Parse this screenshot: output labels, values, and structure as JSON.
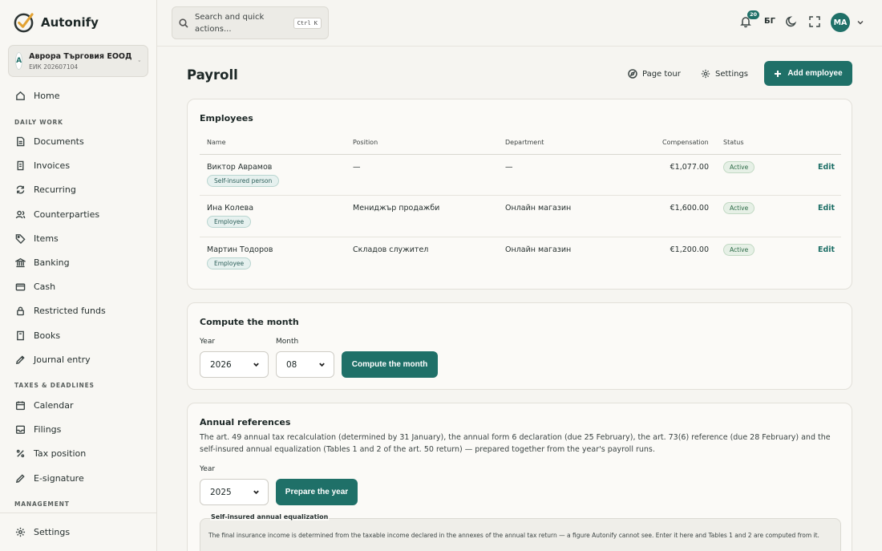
{
  "brand": {
    "name": "Autonify"
  },
  "company": {
    "avatar_letter": "A",
    "name": "Аврора Търговия ЕООД",
    "eik": "ЕИК 202607104"
  },
  "sidebar": {
    "items": [
      {
        "label": "Home",
        "icon": "home-icon"
      },
      {
        "label": "Documents",
        "icon": "document-icon"
      },
      {
        "label": "Invoices",
        "icon": "invoice-icon"
      },
      {
        "label": "Recurring",
        "icon": "recurring-icon"
      },
      {
        "label": "Counterparties",
        "icon": "users-icon"
      },
      {
        "label": "Items",
        "icon": "tag-icon"
      },
      {
        "label": "Banking",
        "icon": "bank-icon"
      },
      {
        "label": "Cash",
        "icon": "cash-icon"
      },
      {
        "label": "Restricted funds",
        "icon": "lock-icon"
      },
      {
        "label": "Books",
        "icon": "book-icon"
      },
      {
        "label": "Journal entry",
        "icon": "pen-icon"
      },
      {
        "label": "Calendar",
        "icon": "calendar-icon"
      },
      {
        "label": "Filings",
        "icon": "inbox-icon"
      },
      {
        "label": "Tax position",
        "icon": "percent-icon"
      },
      {
        "label": "E-signature",
        "icon": "signature-icon"
      },
      {
        "label": "Settings",
        "icon": "gear-icon"
      }
    ],
    "sections": {
      "daily": "DAILY WORK",
      "taxes": "TAXES & DEADLINES",
      "management": "MANAGEMENT"
    }
  },
  "topbar": {
    "search_placeholder": "Search and quick actions...",
    "shortcut": "Ctrl K",
    "notifications_count": "20",
    "language": "БГ",
    "user_initials": "МА"
  },
  "header": {
    "title": "Payroll",
    "page_tour": "Page tour",
    "settings": "Settings",
    "add_employee": "Add employee"
  },
  "employees": {
    "title": "Employees",
    "columns": {
      "name": "Name",
      "position": "Position",
      "department": "Department",
      "compensation": "Compensation",
      "status": "Status"
    },
    "rows": [
      {
        "name": "Виктор Аврамов",
        "type": "Self-insured person",
        "position": "—",
        "department": "—",
        "compensation": "€1,077.00",
        "status": "Active",
        "action": "Edit"
      },
      {
        "name": "Ина Колева",
        "type": "Employee",
        "position": "Мениджър продажби",
        "department": "Онлайн магазин",
        "compensation": "€1,600.00",
        "status": "Active",
        "action": "Edit"
      },
      {
        "name": "Мартин Тодоров",
        "type": "Employee",
        "position": "Складов служител",
        "department": "Онлайн магазин",
        "compensation": "€1,200.00",
        "status": "Active",
        "action": "Edit"
      }
    ]
  },
  "compute": {
    "title": "Compute the month",
    "year_label": "Year",
    "year_value": "2026",
    "month_label": "Month",
    "month_value": "08",
    "button": "Compute the month"
  },
  "annual": {
    "title": "Annual references",
    "description": "The art. 49 annual tax recalculation (determined by 31 January), the annual form 6 declaration (due 25 February), the art. 73(6) reference (due 28 February) and the self-insured annual equalization (Tables 1 and 2 of the art. 50 return) — prepared together from the year's payroll runs.",
    "year_label": "Year",
    "year_value": "2025",
    "button": "Prepare the year",
    "subbox_title": "Self-insured annual equalization",
    "subbox_text": "The final insurance income is determined from the taxable income declared in the annexes of the annual tax return — a figure Autonify cannot see. Enter it here and Tables 1 and 2 are computed from it."
  }
}
